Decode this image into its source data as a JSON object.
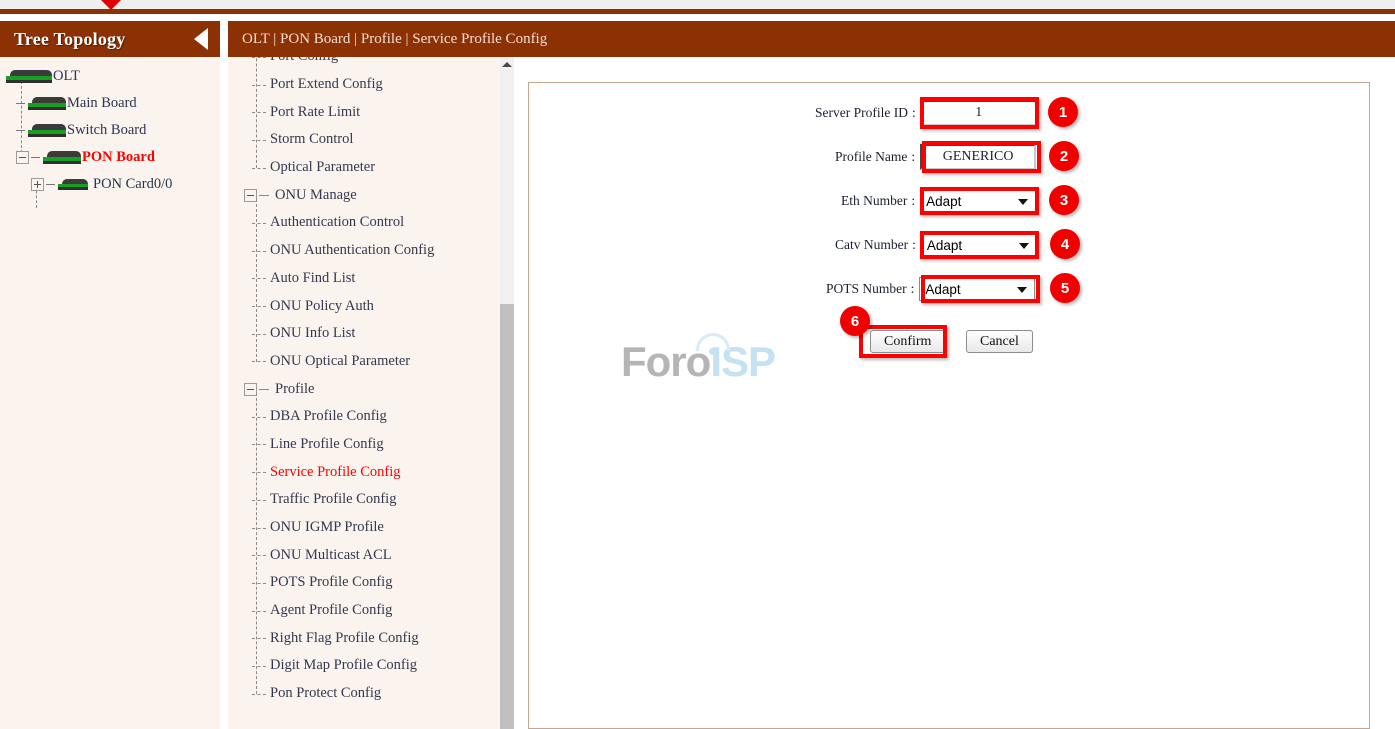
{
  "window": {
    "top_caret_icon": "red-caret-down-icon",
    "accent_color": "#8b3103",
    "highlight_color": "#ff0000",
    "panel_bg": "#faf3ee"
  },
  "sidebar": {
    "title": "Tree Topology",
    "collapse_icon": "collapse-left-arrow-icon",
    "tree": [
      {
        "label": "OLT",
        "level": 0,
        "icon": "board-icon",
        "highlight": false,
        "node": "none"
      },
      {
        "label": "Main Board",
        "level": 1,
        "icon": "board-icon",
        "highlight": false,
        "node": "dash"
      },
      {
        "label": "Switch Board",
        "level": 1,
        "icon": "board-icon",
        "highlight": false,
        "node": "dash"
      },
      {
        "label": "PON Board",
        "level": 1,
        "icon": "board-icon",
        "highlight": true,
        "node": "minus"
      },
      {
        "label": "PON Card0/0",
        "level": 2,
        "icon": "card-icon",
        "highlight": false,
        "node": "plus"
      }
    ]
  },
  "nav": {
    "items": [
      {
        "label": "Port Config",
        "type": "leaf",
        "active": false,
        "clipped": true
      },
      {
        "label": "Port Extend Config",
        "type": "leaf",
        "active": false
      },
      {
        "label": "Port Rate Limit",
        "type": "leaf",
        "active": false
      },
      {
        "label": "Storm Control",
        "type": "leaf",
        "active": false
      },
      {
        "label": "Optical Parameter",
        "type": "leaf",
        "active": false,
        "last": true
      },
      {
        "label": "ONU Manage",
        "type": "group",
        "active": false
      },
      {
        "label": "Authentication Control",
        "type": "leaf",
        "active": false
      },
      {
        "label": "ONU Authentication Config",
        "type": "leaf",
        "active": false
      },
      {
        "label": "Auto Find List",
        "type": "leaf",
        "active": false
      },
      {
        "label": "ONU Policy Auth",
        "type": "leaf",
        "active": false
      },
      {
        "label": "ONU Info List",
        "type": "leaf",
        "active": false
      },
      {
        "label": "ONU Optical Parameter",
        "type": "leaf",
        "active": false,
        "last": true
      },
      {
        "label": "Profile",
        "type": "group",
        "active": false
      },
      {
        "label": "DBA Profile Config",
        "type": "leaf",
        "active": false
      },
      {
        "label": "Line Profile Config",
        "type": "leaf",
        "active": false
      },
      {
        "label": "Service Profile Config",
        "type": "leaf",
        "active": true
      },
      {
        "label": "Traffic Profile Config",
        "type": "leaf",
        "active": false
      },
      {
        "label": "ONU IGMP Profile",
        "type": "leaf",
        "active": false
      },
      {
        "label": "ONU Multicast ACL",
        "type": "leaf",
        "active": false
      },
      {
        "label": "POTS Profile Config",
        "type": "leaf",
        "active": false
      },
      {
        "label": "Agent Profile Config",
        "type": "leaf",
        "active": false
      },
      {
        "label": "Right Flag Profile Config",
        "type": "leaf",
        "active": false
      },
      {
        "label": "Digit Map Profile Config",
        "type": "leaf",
        "active": false
      },
      {
        "label": "Pon Protect Config",
        "type": "leaf",
        "active": false,
        "last": true
      }
    ],
    "scrollbar": {
      "up_icon": "scroll-up-arrow-icon"
    }
  },
  "header": {
    "breadcrumb": "OLT | PON Board | Profile | Service Profile Config"
  },
  "form": {
    "watermark": {
      "part1": "Foro",
      "part2": "ISP"
    },
    "fields": [
      {
        "label": "Server Profile ID",
        "colon": ":",
        "type": "text",
        "value": "1",
        "badge": "1"
      },
      {
        "label": "Profile Name",
        "colon": ":",
        "type": "text",
        "value": "GENERICO",
        "badge": "2"
      },
      {
        "label": "Eth Number",
        "colon": ":",
        "type": "select",
        "value": "Adapt",
        "badge": "3"
      },
      {
        "label": "Catv Number",
        "colon": ":",
        "type": "select",
        "value": "Adapt",
        "badge": "4"
      },
      {
        "label": "POTS Number",
        "colon": ":",
        "type": "select",
        "value": "Adapt",
        "badge": "5"
      }
    ],
    "buttons": {
      "confirm": "Confirm",
      "cancel": "Cancel",
      "confirm_badge": "6"
    }
  }
}
